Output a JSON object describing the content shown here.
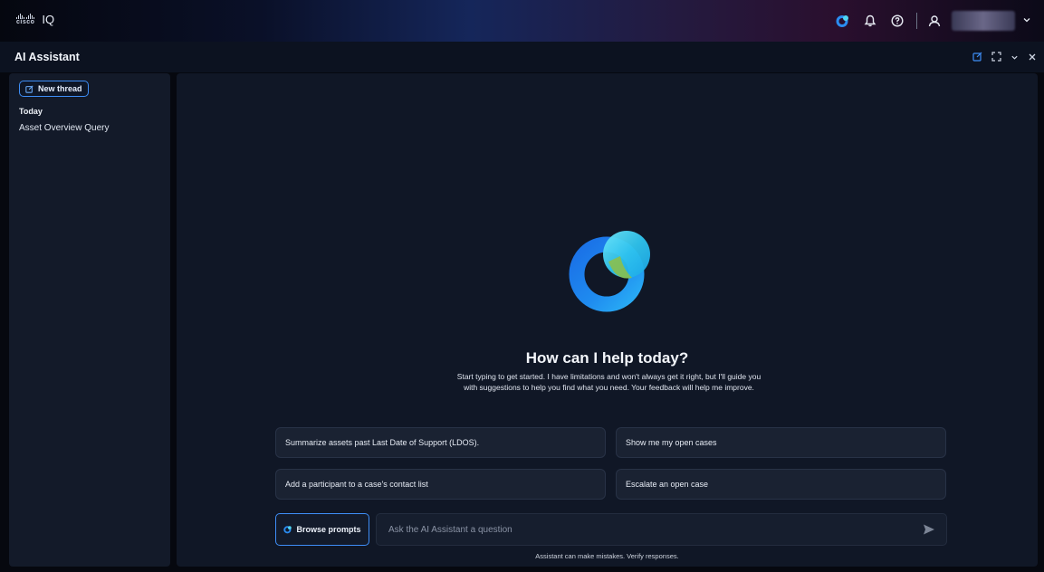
{
  "brand": {
    "logo_text": "cisco",
    "product": "IQ"
  },
  "nav": {
    "icons": [
      "ai-assistant-icon",
      "bell-icon",
      "help-icon",
      "user-icon",
      "chevron-down-icon"
    ]
  },
  "panel": {
    "title": "AI Assistant",
    "action_icons": [
      "new-window-icon",
      "expand-icon",
      "chevron-down-icon",
      "close-icon"
    ]
  },
  "sidebar": {
    "new_thread_label": "New thread",
    "section_heading": "Today",
    "threads": [
      "Asset Overview Query"
    ]
  },
  "main": {
    "heading": "How can I help today?",
    "subtext": "Start typing to get started. I have limitations and won't always get it right, but I'll guide you with suggestions to help you find what you need. Your feedback will help me improve.",
    "suggestions": [
      "Summarize assets past Last Date of Support (LDOS).",
      "Show me my open cases",
      "Add a participant to a case's contact list",
      "Escalate an open case"
    ],
    "browse_prompts_label": "Browse prompts",
    "input_placeholder": "Ask the AI Assistant a question",
    "disclaimer": "Assistant can make mistakes. Verify responses."
  },
  "colors": {
    "accent": "#3e8ef7",
    "background": "#06080f",
    "panel": "#101726"
  }
}
